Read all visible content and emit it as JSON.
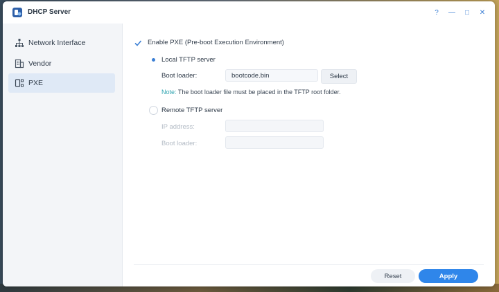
{
  "window": {
    "title": "DHCP Server",
    "controls": [
      "?",
      "—",
      "□",
      "✕"
    ]
  },
  "sidebar": {
    "items": [
      {
        "label": "Network Interface",
        "icon": "network-icon",
        "active": false
      },
      {
        "label": "Vendor",
        "icon": "vendor-icon",
        "active": false
      },
      {
        "label": "PXE",
        "icon": "pxe-icon",
        "active": true
      }
    ]
  },
  "pxe": {
    "enable_label": "Enable PXE (Pre-boot Execution Environment)",
    "enable_checked": true,
    "local": {
      "label": "Local TFTP server",
      "selected": true,
      "boot_loader_label": "Boot loader:",
      "boot_loader_value": "bootcode.bin",
      "select_label": "Select",
      "note_prefix": "Note:",
      "note_text": " The boot loader file must be placed in the TFTP root folder."
    },
    "remote": {
      "label": "Remote TFTP server",
      "selected": false,
      "ip_label": "IP address:",
      "ip_value": "",
      "boot_loader_label": "Boot loader:",
      "boot_loader_value": ""
    }
  },
  "footer": {
    "reset_label": "Reset",
    "apply_label": "Apply"
  },
  "colors": {
    "accent": "#2f86ea",
    "note": "#2fa4b0",
    "active_nav": "#dfe9f6"
  }
}
